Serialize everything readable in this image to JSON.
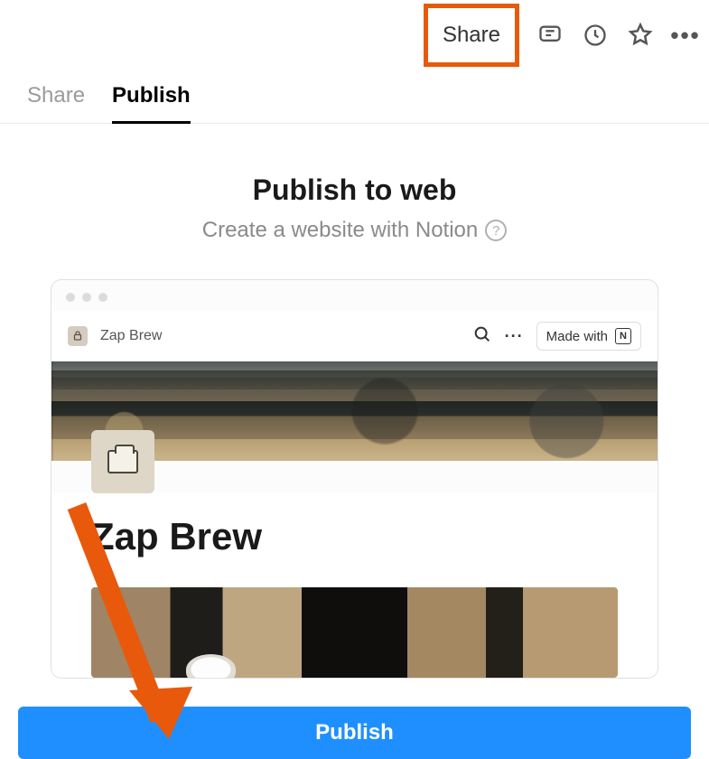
{
  "topbar": {
    "share_label": "Share"
  },
  "tabs": {
    "share": "Share",
    "publish": "Publish"
  },
  "content": {
    "title": "Publish to web",
    "subtitle": "Create a website with Notion"
  },
  "preview": {
    "page_title": "Zap Brew",
    "made_with_label": "Made with",
    "notion_glyph": "N",
    "page_heading": "Zap Brew"
  },
  "actions": {
    "publish_label": "Publish"
  }
}
